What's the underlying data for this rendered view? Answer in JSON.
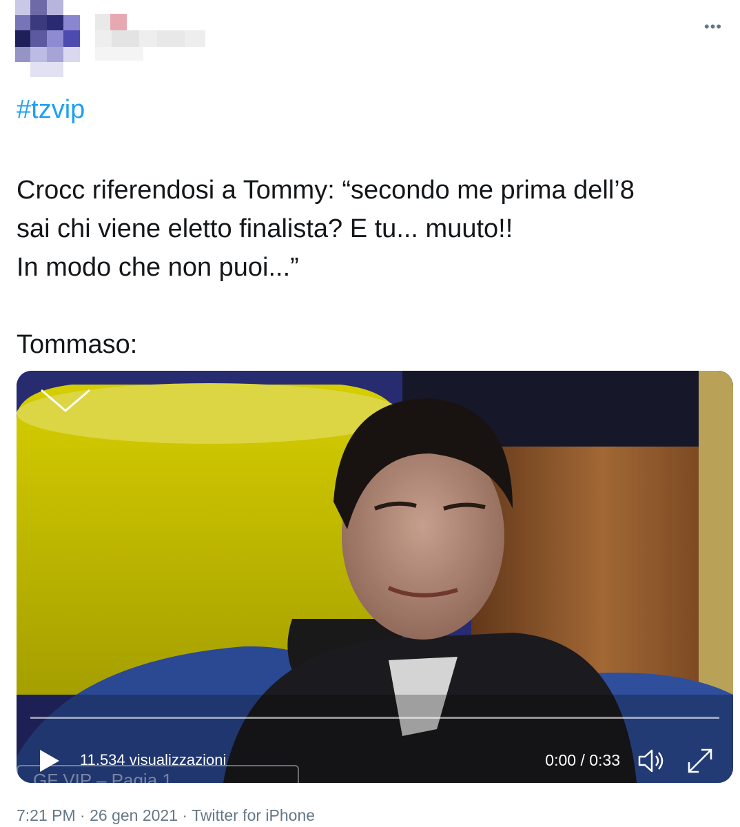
{
  "tweet": {
    "hashtag": "#tzvip",
    "lines": [
      "Crocc riferendosi a Tommy: “secondo me prima dell’8",
      "sai chi viene eletto finalista? E tu... muuto!!",
      "In modo che non puoi...”"
    ],
    "line_after_gap": "Tommaso:"
  },
  "video": {
    "views": "11.534 visualizzazioni",
    "time": "0:00 / 0:33",
    "overlay_caption": "GF VIP – Pagia 1"
  },
  "meta": {
    "time": "7:21 PM",
    "date": "26 gen 2021",
    "source": "Twitter for iPhone",
    "separator": "·"
  },
  "colors": {
    "hashtag": "#1da1f2",
    "text": "#14171a",
    "muted": "#657786"
  },
  "icons": [
    "more-icon",
    "collapse-chevron-icon",
    "play-icon",
    "volume-icon",
    "fullscreen-icon"
  ]
}
